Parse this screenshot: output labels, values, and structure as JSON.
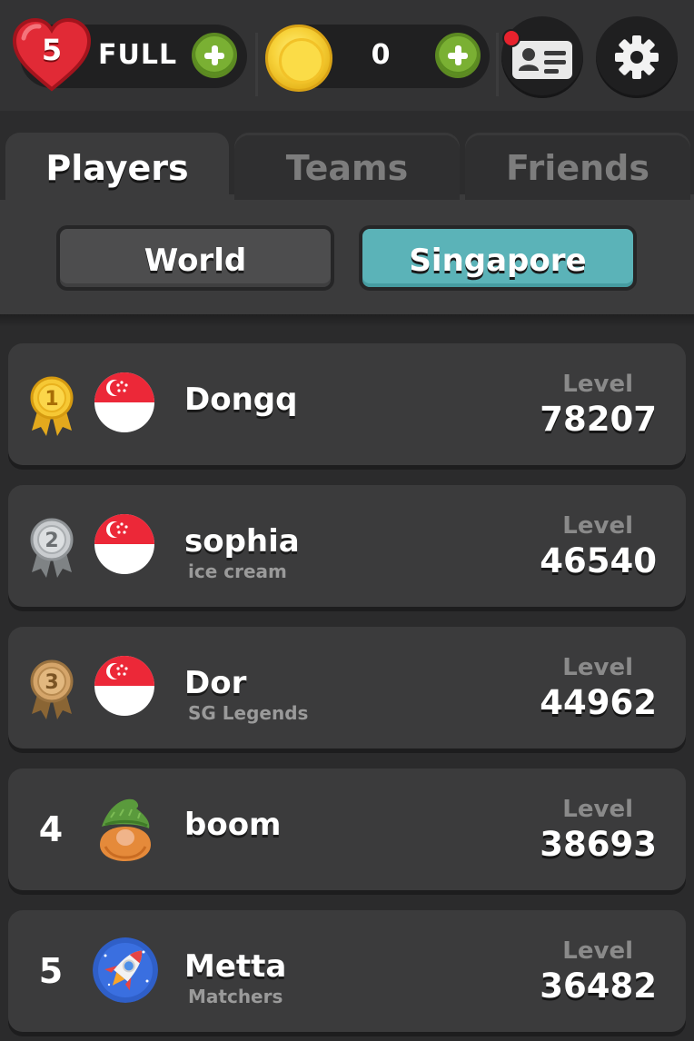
{
  "header": {
    "lives_count": "5",
    "lives_status": "FULL",
    "coins_count": "0"
  },
  "tabs": [
    {
      "label": "Players",
      "active": true
    },
    {
      "label": "Teams",
      "active": false
    },
    {
      "label": "Friends",
      "active": false
    }
  ],
  "regions": [
    {
      "label": "World",
      "active": false
    },
    {
      "label": "Singapore",
      "active": true
    }
  ],
  "level_label": "Level",
  "leaderboard": [
    {
      "rank": "1",
      "rank_icon": "gold-medal-icon",
      "avatar": "singapore-flag-icon",
      "name": "Dongq",
      "team": "",
      "level": "78207"
    },
    {
      "rank": "2",
      "rank_icon": "silver-medal-icon",
      "avatar": "singapore-flag-icon",
      "name": "sophia",
      "team": "ice cream",
      "level": "46540"
    },
    {
      "rank": "3",
      "rank_icon": "bronze-medal-icon",
      "avatar": "singapore-flag-icon",
      "name": "Dor",
      "team": "SG Legends",
      "level": "44962"
    },
    {
      "rank": "4",
      "rank_icon": "",
      "avatar": "gnome-avatar-icon",
      "name": "boom",
      "team": "",
      "level": "38693"
    },
    {
      "rank": "5",
      "rank_icon": "",
      "avatar": "rocket-avatar-icon",
      "name": "Metta",
      "team": "Matchers",
      "level": "36482"
    }
  ],
  "colors": {
    "background": "#2b2b2c",
    "panel": "#3b3b3c",
    "accent_teal": "#5bb3b8",
    "plus_green": "#7ab033",
    "heart_red": "#e12a36",
    "notification_red": "#e8222d"
  }
}
